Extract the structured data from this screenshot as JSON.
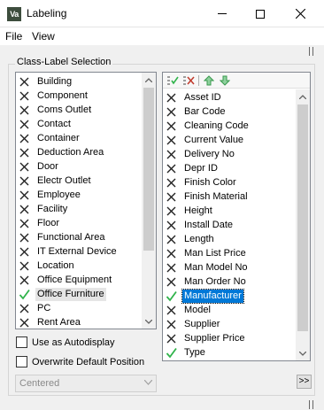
{
  "window": {
    "icon_text": "Va",
    "title": "Labeling"
  },
  "menu": {
    "file": "File",
    "view": "View"
  },
  "group": {
    "title": "Class-Label Selection"
  },
  "classes": [
    {
      "label": "Building",
      "icon": "cross-icon"
    },
    {
      "label": "Component",
      "icon": "cross-icon"
    },
    {
      "label": "Coms Outlet",
      "icon": "cross-icon"
    },
    {
      "label": "Contact",
      "icon": "cross-icon"
    },
    {
      "label": "Container",
      "icon": "cross-icon"
    },
    {
      "label": "Deduction Area",
      "icon": "cross-icon"
    },
    {
      "label": "Door",
      "icon": "cross-icon"
    },
    {
      "label": "Electr Outlet",
      "icon": "cross-icon"
    },
    {
      "label": "Employee",
      "icon": "cross-icon"
    },
    {
      "label": "Facility",
      "icon": "cross-icon"
    },
    {
      "label": "Floor",
      "icon": "cross-icon"
    },
    {
      "label": "Functional Area",
      "icon": "cross-icon"
    },
    {
      "label": "IT External Device",
      "icon": "cross-icon"
    },
    {
      "label": "Location",
      "icon": "cross-icon"
    },
    {
      "label": "Office Equipment",
      "icon": "cross-icon"
    },
    {
      "label": "Office Furniture",
      "icon": "check-icon",
      "selected": true
    },
    {
      "label": "PC",
      "icon": "cross-icon"
    },
    {
      "label": "Rent Area",
      "icon": "cross-icon"
    }
  ],
  "labels": [
    {
      "label": "Asset ID",
      "icon": "cross-icon"
    },
    {
      "label": "Bar Code",
      "icon": "cross-icon"
    },
    {
      "label": "Cleaning Code",
      "icon": "cross-icon"
    },
    {
      "label": "Current Value",
      "icon": "cross-icon"
    },
    {
      "label": "Delivery No",
      "icon": "cross-icon"
    },
    {
      "label": "Depr ID",
      "icon": "cross-icon"
    },
    {
      "label": "Finish Color",
      "icon": "cross-icon"
    },
    {
      "label": "Finish Material",
      "icon": "cross-icon"
    },
    {
      "label": "Height",
      "icon": "cross-icon"
    },
    {
      "label": "Install Date",
      "icon": "cross-icon"
    },
    {
      "label": "Length",
      "icon": "cross-icon"
    },
    {
      "label": "Man List Price",
      "icon": "cross-icon"
    },
    {
      "label": "Man Model No",
      "icon": "cross-icon"
    },
    {
      "label": "Man Order No",
      "icon": "cross-icon"
    },
    {
      "label": "Manufacturer",
      "icon": "check-icon",
      "selected": true
    },
    {
      "label": "Model",
      "icon": "cross-icon"
    },
    {
      "label": "Supplier",
      "icon": "cross-icon"
    },
    {
      "label": "Supplier Price",
      "icon": "cross-icon"
    },
    {
      "label": "Type",
      "icon": "check-icon"
    }
  ],
  "options": {
    "autodisplay": "Use as Autodisplay",
    "overwrite": "Overwrite Default Position",
    "position_value": "Centered",
    "expand_button": ">>"
  },
  "colors": {
    "check": "#2fb34a",
    "cross": "#222222",
    "selection_blue": "#0078d7",
    "selection_grey": "#e5e5e5"
  }
}
